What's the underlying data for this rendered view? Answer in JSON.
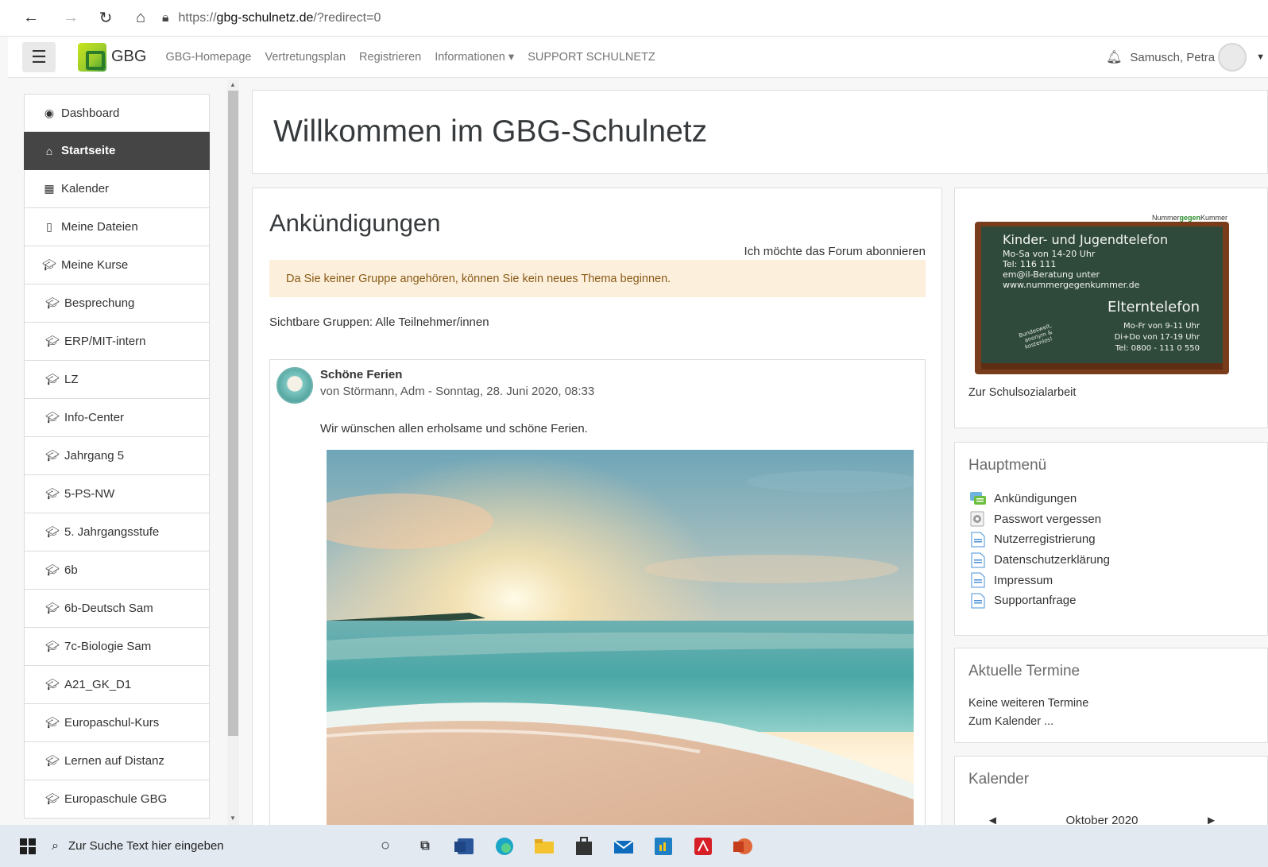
{
  "browser": {
    "url_proto": "https://",
    "url_host": "gbg-schulnetz.de",
    "url_rest": "/?redirect=0"
  },
  "navbar": {
    "site_name": "GBG",
    "links": [
      "GBG-Homepage",
      "Vertretungsplan",
      "Registrieren",
      "Informationen ▾",
      "SUPPORT SCHULNETZ"
    ],
    "user_name": "Samusch, Petra"
  },
  "sidebar": {
    "items": [
      {
        "label": "Dashboard",
        "icon": "dashboard-icon"
      },
      {
        "label": "Startseite",
        "icon": "home-icon",
        "active": true
      },
      {
        "label": "Kalender",
        "icon": "calendar-icon"
      },
      {
        "label": "Meine Dateien",
        "icon": "file-icon"
      },
      {
        "label": "Meine Kurse",
        "icon": "graduation-cap-icon"
      },
      {
        "label": "Besprechung",
        "icon": "graduation-cap-icon"
      },
      {
        "label": "ERP/MIT-intern",
        "icon": "graduation-cap-icon"
      },
      {
        "label": "LZ",
        "icon": "graduation-cap-icon"
      },
      {
        "label": "Info-Center",
        "icon": "graduation-cap-icon"
      },
      {
        "label": "Jahrgang 5",
        "icon": "graduation-cap-icon"
      },
      {
        "label": "5-PS-NW",
        "icon": "graduation-cap-icon"
      },
      {
        "label": "5. Jahrgangsstufe",
        "icon": "graduation-cap-icon"
      },
      {
        "label": "6b",
        "icon": "graduation-cap-icon"
      },
      {
        "label": "6b-Deutsch Sam",
        "icon": "graduation-cap-icon"
      },
      {
        "label": "7c-Biologie Sam",
        "icon": "graduation-cap-icon"
      },
      {
        "label": "A21_GK_D1",
        "icon": "graduation-cap-icon"
      },
      {
        "label": "Europaschul-Kurs",
        "icon": "graduation-cap-icon"
      },
      {
        "label": "Lernen auf Distanz",
        "icon": "graduation-cap-icon"
      },
      {
        "label": "Europaschule GBG",
        "icon": "graduation-cap-icon"
      }
    ]
  },
  "main": {
    "welcome_title": "Willkommen im GBG-Schulnetz",
    "forum": {
      "title": "Ankündigungen",
      "subscribe_link": "Ich möchte das Forum abonnieren",
      "alert": "Da Sie keiner Gruppe angehören, können Sie kein neues Thema beginnen.",
      "groups": "Sichtbare Gruppen: Alle Teilnehmer/innen",
      "post": {
        "subject": "Schöne Ferien",
        "author_line": "von Störmann, Adm - Sonntag, 28. Juni 2020, 08:33",
        "body": "Wir wünschen allen erholsame und schöne Ferien."
      }
    }
  },
  "blocks": {
    "kjt": {
      "brand_prefix": "Nummer",
      "brand_mid": "gegen",
      "brand_suffix": "Kummer",
      "line1": "Kinder- und Jugendtelefon",
      "line2": "Mo-Sa von 14-20 Uhr",
      "line3": "Tel: 116 111",
      "line4": "em@il-Beratung unter",
      "line5": "www.nummergegenkummer.de",
      "line6": "Elterntelefon",
      "line7": "Mo-Fr von 9-11 Uhr",
      "line8": "Di+Do von 17-19 Uhr",
      "line9": "Tel: 0800 - 111 0 550",
      "stamp1": "Bundesweit,",
      "stamp2": "anonym &",
      "stamp3": "kostenlos!",
      "link": "Zur Schulsozialarbeit"
    },
    "mainmenu": {
      "title": "Hauptmenü",
      "items": [
        {
          "label": "Ankündigungen",
          "icon": "forum-icon"
        },
        {
          "label": "Passwort vergessen",
          "icon": "settings-icon"
        },
        {
          "label": "Nutzerregistrierung",
          "icon": "page-icon"
        },
        {
          "label": "Datenschutzerklärung",
          "icon": "page-icon"
        },
        {
          "label": "Impressum",
          "icon": "page-icon"
        },
        {
          "label": "Supportanfrage",
          "icon": "page-icon"
        }
      ]
    },
    "events": {
      "title": "Aktuelle Termine",
      "none": "Keine weiteren Termine",
      "calendar_link": "Zum Kalender ..."
    },
    "calendar": {
      "title": "Kalender",
      "prev": "◄",
      "month": "Oktober 2020",
      "next": "►"
    }
  },
  "taskbar": {
    "search_placeholder": "Zur Suche Text hier eingeben"
  },
  "colors": {
    "active_nav": "#454545",
    "alert_bg": "#fcefdc",
    "alert_text": "#8a5b17",
    "chalkboard": "#2f4a3a",
    "frame": "#7a3d1c"
  }
}
